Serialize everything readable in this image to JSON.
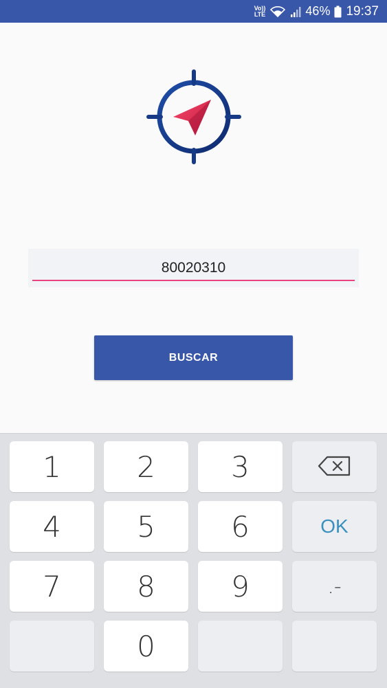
{
  "status_bar": {
    "volte_line1": "Vo))",
    "volte_line2": "LTE",
    "battery_percent": "46%",
    "time": "19:37",
    "background_color": "#3957a8"
  },
  "search": {
    "value": "80020310",
    "underline_color": "#e8437f"
  },
  "button": {
    "label": "BUSCAR",
    "color": "#3957a8"
  },
  "keyboard": {
    "keys": [
      "1",
      "2",
      "3",
      "4",
      "5",
      "6",
      "7",
      "8",
      "9",
      "0"
    ],
    "ok_label": "OK",
    "dot_label": ".-",
    "backspace_icon": "backspace-icon"
  },
  "logo": {
    "icon": "compass-navigation-icon",
    "ring_color": "#1a3a8a",
    "arrow_color": "#e8304a"
  }
}
